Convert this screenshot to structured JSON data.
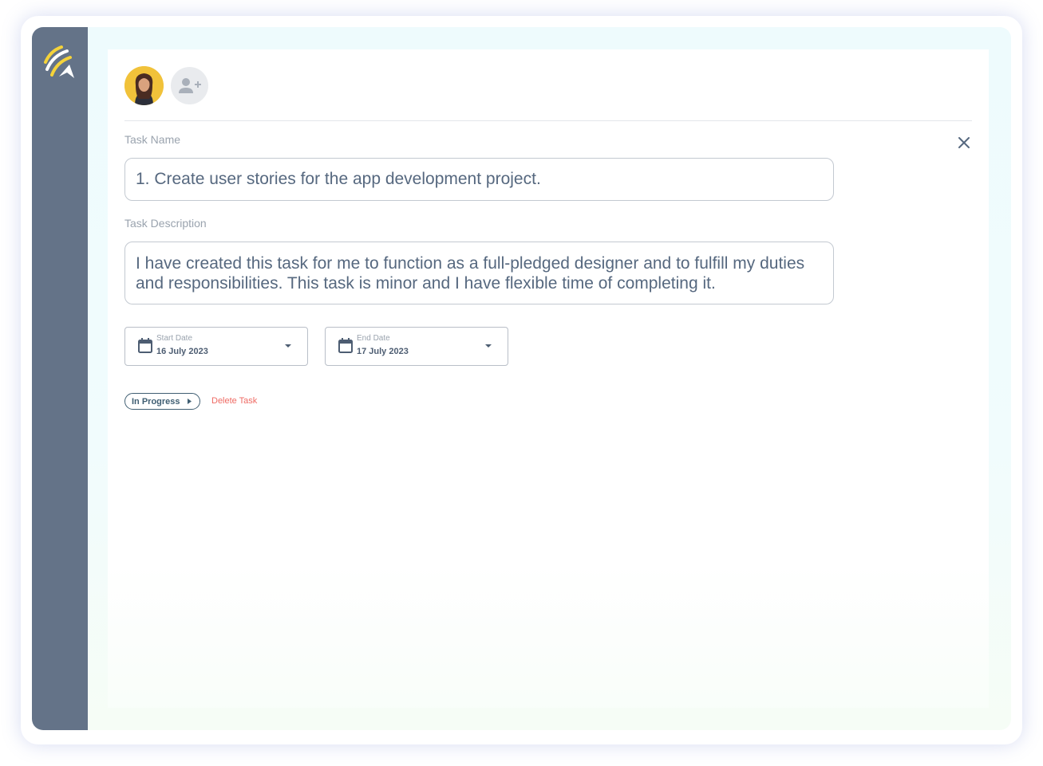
{
  "assignees": {
    "avatar_icon": "user-avatar-photo",
    "add_user_icon": "add-user-icon"
  },
  "close_icon": "close-icon",
  "task_name": {
    "label": "Task Name",
    "value": "1. Create user stories for the app development project."
  },
  "task_description": {
    "label": "Task Description",
    "value": "I have created this task for me to function as a full-pledged designer and to fulfill my duties and responsibilities. This task is minor and I have flexible time of completing it."
  },
  "start_date": {
    "label": "Start Date",
    "value": "16 July 2023",
    "icon": "calendar-icon"
  },
  "end_date": {
    "label": "End Date",
    "value": "17 July 2023",
    "icon": "calendar-icon"
  },
  "status": {
    "label": "In Progress",
    "icon": "caret-right-icon"
  },
  "delete_label": "Delete Task",
  "colors": {
    "sidebar": "#647388",
    "logo_yellow": "#f5d33a",
    "text": "#56687f",
    "delete": "#ef6a63",
    "status_border": "#3f5e72"
  }
}
